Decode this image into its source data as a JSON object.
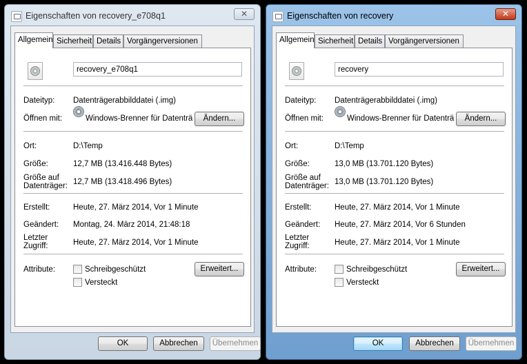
{
  "dialogs": [
    {
      "title": "Eigenschaften von recovery_e708q1",
      "close_glyph": "✕",
      "tabs": [
        "Allgemein",
        "Sicherheit",
        "Details",
        "Vorgängerversionen"
      ],
      "file_name": "recovery_e708q1",
      "labels": {
        "type": "Dateityp:",
        "open_with": "Öffnen mit:",
        "location": "Ort:",
        "size": "Größe:",
        "size_on_disk": "Größe auf Datenträger:",
        "created": "Erstellt:",
        "modified": "Geändert:",
        "accessed": "Letzter Zugriff:",
        "attributes": "Attribute:"
      },
      "values": {
        "type": "Datenträgerabbilddatei (.img)",
        "open_with": "Windows-Brenner für Datenträ",
        "location": "D:\\Temp",
        "size": "12,7 MB (13.416.448 Bytes)",
        "size_on_disk": "12,7 MB (13.418.496 Bytes)",
        "created": "Heute, 27. März 2014, Vor 1 Minute",
        "modified": "Montag, 24. März 2014, 21:48:18",
        "accessed": "Heute, 27. März 2014, Vor 1 Minute"
      },
      "buttons": {
        "change": "Ändern...",
        "advanced": "Erweitert...",
        "ok": "OK",
        "cancel": "Abbrechen",
        "apply": "Übernehmen"
      },
      "checkboxes": {
        "readonly": "Schreibgeschützt",
        "hidden": "Versteckt"
      }
    },
    {
      "title": "Eigenschaften von recovery",
      "close_glyph": "✕",
      "tabs": [
        "Allgemein",
        "Sicherheit",
        "Details",
        "Vorgängerversionen"
      ],
      "file_name": "recovery",
      "labels": {
        "type": "Dateityp:",
        "open_with": "Öffnen mit:",
        "location": "Ort:",
        "size": "Größe:",
        "size_on_disk": "Größe auf Datenträger:",
        "created": "Erstellt:",
        "modified": "Geändert:",
        "accessed": "Letzter Zugriff:",
        "attributes": "Attribute:"
      },
      "values": {
        "type": "Datenträgerabbilddatei (.img)",
        "open_with": "Windows-Brenner für Datenträ",
        "location": "D:\\Temp",
        "size": "13,0 MB (13.701.120 Bytes)",
        "size_on_disk": "13,0 MB (13.701.120 Bytes)",
        "created": "Heute, 27. März 2014, Vor 1 Minute",
        "modified": "Heute, 27. März 2014, Vor 6 Stunden",
        "accessed": "Heute, 27. März 2014, Vor 1 Minute"
      },
      "buttons": {
        "change": "Ändern...",
        "advanced": "Erweitert...",
        "ok": "OK",
        "cancel": "Abbrechen",
        "apply": "Übernehmen"
      },
      "checkboxes": {
        "readonly": "Schreibgeschützt",
        "hidden": "Versteckt"
      }
    }
  ]
}
